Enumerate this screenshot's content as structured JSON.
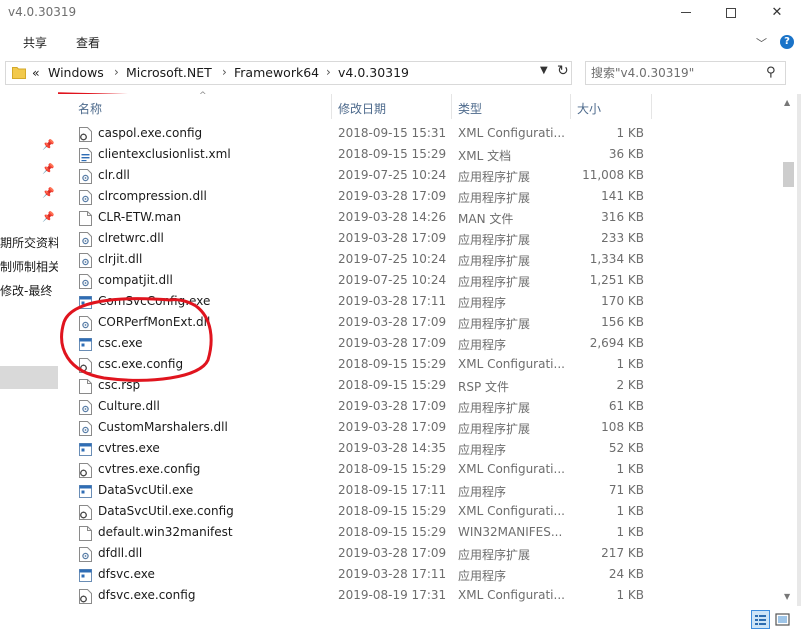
{
  "window": {
    "title": "v4.0.30319"
  },
  "ribbon": {
    "tabs": [
      {
        "label": "共享"
      },
      {
        "label": "查看"
      }
    ]
  },
  "address": {
    "overflow": "«",
    "crumbs": [
      "Windows",
      "Microsoft.NET",
      "Framework64",
      "v4.0.30319"
    ]
  },
  "search": {
    "placeholder": "搜索\"v4.0.30319\""
  },
  "nav": {
    "items": [
      "期所交资料",
      "制师制相关",
      "修改-最终"
    ]
  },
  "columns": {
    "name": "名称",
    "date": "修改日期",
    "type": "类型",
    "size": "大小"
  },
  "files": [
    {
      "name": "caspol.exe.config",
      "date": "2018-09-15 15:31",
      "type": "XML Configurati...",
      "size": "1 KB",
      "icon": "config-file-icon"
    },
    {
      "name": "clientexclusionlist.xml",
      "date": "2018-09-15 15:29",
      "type": "XML 文档",
      "size": "36 KB",
      "icon": "xml-file-icon"
    },
    {
      "name": "clr.dll",
      "date": "2019-07-25 10:24",
      "type": "应用程序扩展",
      "size": "11,008 KB",
      "icon": "dll-file-icon"
    },
    {
      "name": "clrcompression.dll",
      "date": "2019-03-28 17:09",
      "type": "应用程序扩展",
      "size": "141 KB",
      "icon": "dll-file-icon"
    },
    {
      "name": "CLR-ETW.man",
      "date": "2019-03-28 14:26",
      "type": "MAN 文件",
      "size": "316 KB",
      "icon": "blank-file-icon"
    },
    {
      "name": "clretwrc.dll",
      "date": "2019-03-28 17:09",
      "type": "应用程序扩展",
      "size": "233 KB",
      "icon": "dll-file-icon"
    },
    {
      "name": "clrjit.dll",
      "date": "2019-07-25 10:24",
      "type": "应用程序扩展",
      "size": "1,334 KB",
      "icon": "dll-file-icon"
    },
    {
      "name": "compatjit.dll",
      "date": "2019-07-25 10:24",
      "type": "应用程序扩展",
      "size": "1,251 KB",
      "icon": "dll-file-icon"
    },
    {
      "name": "ComSvcConfig.exe",
      "date": "2019-03-28 17:11",
      "type": "应用程序",
      "size": "170 KB",
      "icon": "exe-file-icon"
    },
    {
      "name": "CORPerfMonExt.dll",
      "date": "2019-03-28 17:09",
      "type": "应用程序扩展",
      "size": "156 KB",
      "icon": "dll-file-icon"
    },
    {
      "name": "csc.exe",
      "date": "2019-03-28 17:09",
      "type": "应用程序",
      "size": "2,694 KB",
      "icon": "exe-file-icon"
    },
    {
      "name": "csc.exe.config",
      "date": "2018-09-15 15:29",
      "type": "XML Configurati...",
      "size": "1 KB",
      "icon": "config-file-icon"
    },
    {
      "name": "csc.rsp",
      "date": "2018-09-15 15:29",
      "type": "RSP 文件",
      "size": "2 KB",
      "icon": "blank-file-icon"
    },
    {
      "name": "Culture.dll",
      "date": "2019-03-28 17:09",
      "type": "应用程序扩展",
      "size": "61 KB",
      "icon": "dll-file-icon"
    },
    {
      "name": "CustomMarshalers.dll",
      "date": "2019-03-28 17:09",
      "type": "应用程序扩展",
      "size": "108 KB",
      "icon": "dll-file-icon"
    },
    {
      "name": "cvtres.exe",
      "date": "2019-03-28 14:35",
      "type": "应用程序",
      "size": "52 KB",
      "icon": "exe-file-icon"
    },
    {
      "name": "cvtres.exe.config",
      "date": "2018-09-15 15:29",
      "type": "XML Configurati...",
      "size": "1 KB",
      "icon": "config-file-icon"
    },
    {
      "name": "DataSvcUtil.exe",
      "date": "2018-09-15 17:11",
      "type": "应用程序",
      "size": "71 KB",
      "icon": "exe-file-icon"
    },
    {
      "name": "DataSvcUtil.exe.config",
      "date": "2018-09-15 15:29",
      "type": "XML Configurati...",
      "size": "1 KB",
      "icon": "config-file-icon"
    },
    {
      "name": "default.win32manifest",
      "date": "2018-09-15 15:29",
      "type": "WIN32MANIFES...",
      "size": "1 KB",
      "icon": "blank-file-icon"
    },
    {
      "name": "dfdll.dll",
      "date": "2019-03-28 17:09",
      "type": "应用程序扩展",
      "size": "217 KB",
      "icon": "dll-file-icon"
    },
    {
      "name": "dfsvc.exe",
      "date": "2019-03-28 17:11",
      "type": "应用程序",
      "size": "24 KB",
      "icon": "exe-file-icon"
    },
    {
      "name": "dfsvc.exe.config",
      "date": "2019-08-19 17:31",
      "type": "XML Configurati...",
      "size": "1 KB",
      "icon": "config-file-icon"
    }
  ],
  "colors": {
    "annotation": "#e0141e",
    "selection": "#cce4f7",
    "accent": "#1a73c8",
    "folder": "#f2c94c"
  }
}
